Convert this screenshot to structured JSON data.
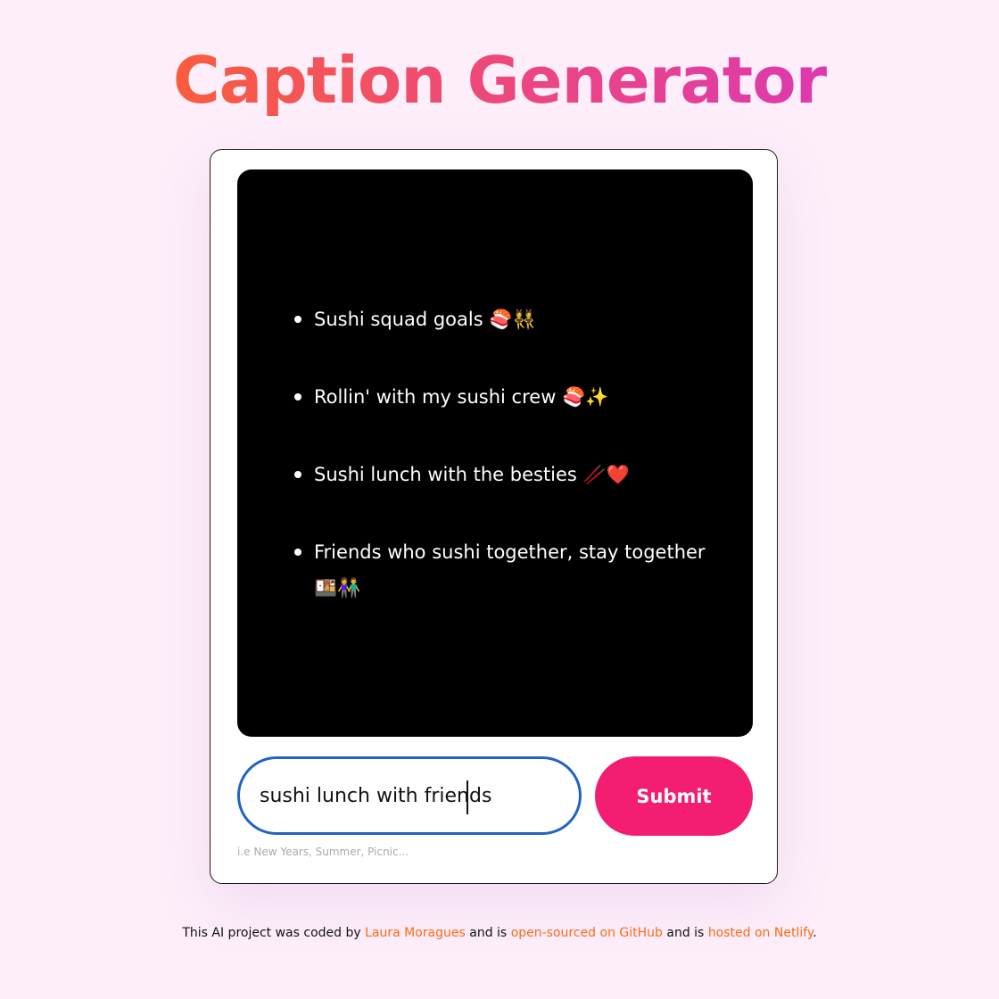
{
  "header": {
    "title": "Caption Generator"
  },
  "captions": [
    {
      "text": "Sushi squad goals",
      "emoji": "🍣👯"
    },
    {
      "text": "Rollin' with my sushi crew",
      "emoji": "🍣✨"
    },
    {
      "text": "Sushi lunch with the besties",
      "emoji": "🥢❤️"
    },
    {
      "text": "Friends who sushi together, stay together",
      "emoji": "🍱👫"
    }
  ],
  "form": {
    "input_value": "sushi lunch with friends",
    "hint": "i.e New Years, Summer, Picnic...",
    "submit_label": "Submit"
  },
  "footer": {
    "prefix": "This AI project was coded by",
    "author_link": "Laura Moragues",
    "middle": "and is",
    "github_link": "open-sourced on GitHub",
    "middle2": "and is",
    "netlify_link": "hosted on Netlify",
    "suffix": "."
  },
  "colors": {
    "background": "#fdeefa",
    "title_gradient_start": "#ff6a1a",
    "title_gradient_end": "#d531c9",
    "submit_button": "#f31d72",
    "input_border": "#1f64c4",
    "link": "#ff6a13"
  }
}
